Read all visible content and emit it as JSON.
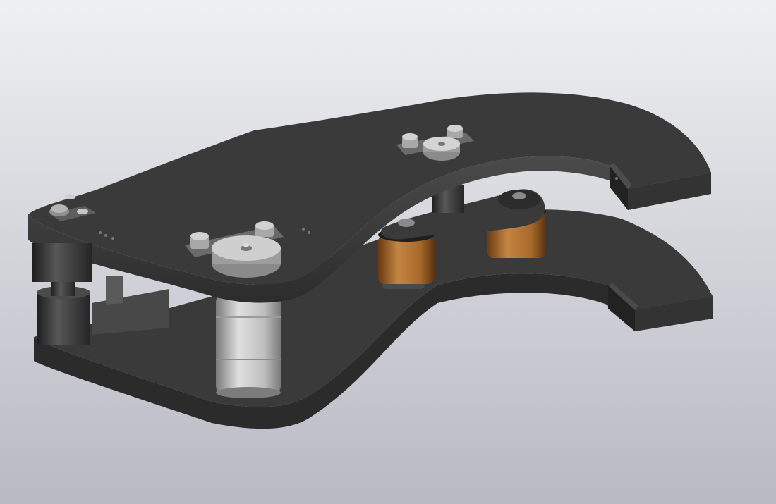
{
  "scene": {
    "description_visible_text": "",
    "colors": {
      "background_top": "#eceef0",
      "background_bottom": "#b9bac4",
      "plate_face": "#3b3b3b",
      "plate_edge": "#2a2a2a",
      "plate_edge_light": "#4a4a4a",
      "metal_light": "#d7d7d7",
      "metal_mid": "#a9a9a9",
      "metal_dark": "#6d6d6d",
      "bronze": "#b06f2e",
      "bronze_dark": "#6b3c15"
    },
    "parts": [
      "upper-plate",
      "lower-plate",
      "front-spacer-upper",
      "front-spacer-lower",
      "center-pivot-cylinder",
      "rear-pivot-cylinder",
      "bronze-roller-left",
      "bronze-roller-right",
      "link-plate",
      "clamp-bolts",
      "jaw-tip-blocks"
    ]
  }
}
